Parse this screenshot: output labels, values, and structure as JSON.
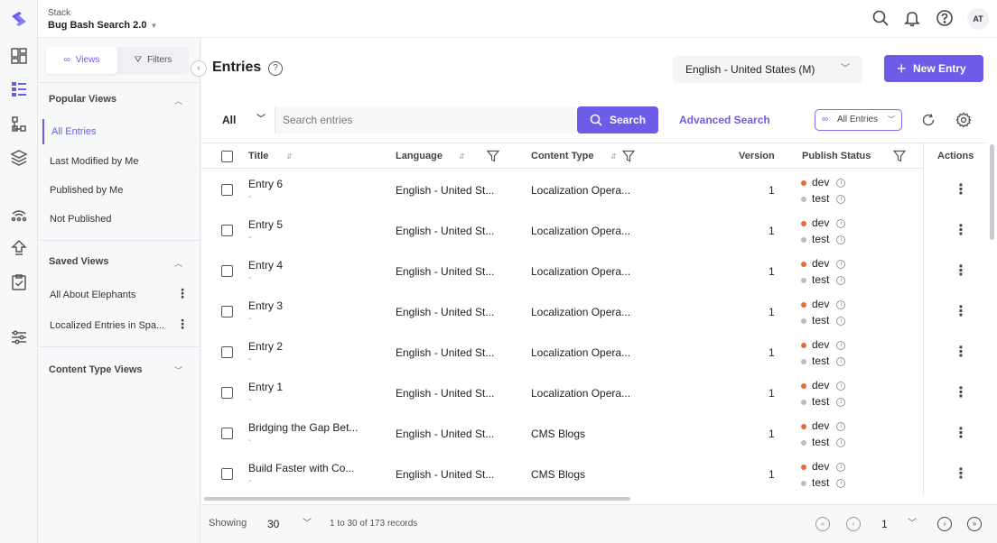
{
  "header": {
    "stack_label": "Stack",
    "stack_name": "Bug Bash Search 2.0",
    "avatar": "AT",
    "icons": [
      "search-icon",
      "bell-icon",
      "help-icon"
    ]
  },
  "rail": {
    "icons": [
      "contentstack-logo-icon",
      "dashboard-icon",
      "entries-icon",
      "content-models-icon",
      "assets-icon",
      "releases-icon",
      "deploy-icon",
      "tasks-icon",
      "settings-sliders-icon"
    ]
  },
  "views_panel": {
    "tab_views": "Views",
    "tab_filters": "Filters",
    "popular_title": "Popular Views",
    "popular_items": [
      "All Entries",
      "Last Modified by Me",
      "Published by Me",
      "Not Published"
    ],
    "saved_title": "Saved Views",
    "saved_items": [
      "All About Elephants",
      "Localized Entries in Spa..."
    ],
    "content_type_title": "Content Type Views"
  },
  "main": {
    "title": "Entries",
    "locale": "English - United States (M)",
    "new_entry": "New Entry",
    "filter_all": "All",
    "search_placeholder": "Search entries",
    "search_button": "Search",
    "advanced_search": "Advanced Search",
    "all_entries_filter": "All Entries"
  },
  "table": {
    "columns": {
      "title": "Title",
      "language": "Language",
      "content_type": "Content Type",
      "version": "Version",
      "publish_status": "Publish Status",
      "actions": "Actions"
    },
    "rows": [
      {
        "title": "Entry 6",
        "sub": "-",
        "language": "English - United St...",
        "content_type": "Localization Opera...",
        "version": "1",
        "env1": "dev",
        "env2": "test"
      },
      {
        "title": "Entry 5",
        "sub": "-",
        "language": "English - United St...",
        "content_type": "Localization Opera...",
        "version": "1",
        "env1": "dev",
        "env2": "test"
      },
      {
        "title": "Entry 4",
        "sub": "-",
        "language": "English - United St...",
        "content_type": "Localization Opera...",
        "version": "1",
        "env1": "dev",
        "env2": "test"
      },
      {
        "title": "Entry 3",
        "sub": "-",
        "language": "English - United St...",
        "content_type": "Localization Opera...",
        "version": "1",
        "env1": "dev",
        "env2": "test"
      },
      {
        "title": "Entry 2",
        "sub": "-",
        "language": "English - United St...",
        "content_type": "Localization Opera...",
        "version": "1",
        "env1": "dev",
        "env2": "test"
      },
      {
        "title": "Entry 1",
        "sub": "-",
        "language": "English - United St...",
        "content_type": "Localization Opera...",
        "version": "1",
        "env1": "dev",
        "env2": "test"
      },
      {
        "title": "Bridging the Gap Bet...",
        "sub": "-",
        "language": "English - United St...",
        "content_type": "CMS Blogs",
        "version": "1",
        "env1": "dev",
        "env2": "test"
      },
      {
        "title": "Build Faster with Co...",
        "sub": "-",
        "language": "English - United St...",
        "content_type": "CMS Blogs",
        "version": "1",
        "env1": "dev",
        "env2": "test"
      }
    ]
  },
  "footer": {
    "showing_label": "Showing",
    "page_size": "30",
    "range": "1 to 30 of 173 records",
    "page": "1"
  },
  "colors": {
    "accent": "#6c5ce7",
    "dev_dot": "#e8693a",
    "test_dot": "#b9bcc2"
  }
}
